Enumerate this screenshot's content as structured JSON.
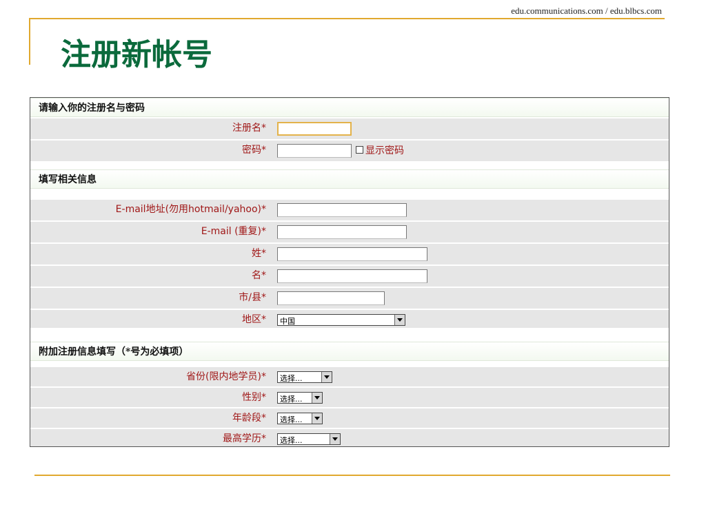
{
  "slide": {
    "source": "edu.communications.com / edu.blbcs.com",
    "title": "注册新帐号"
  },
  "form": {
    "sections": {
      "account": "请输入你的注册名与密码",
      "info": "填写相关信息",
      "extra": "附加注册信息填写（*号为必填项）"
    },
    "fields": {
      "username": {
        "label": "注册名*",
        "value": ""
      },
      "password": {
        "label": "密码*",
        "value": "",
        "show_password_label": "显示密码"
      },
      "email": {
        "label": "E-mail地址(勿用hotmail/yahoo)*",
        "value": ""
      },
      "email_confirm": {
        "label": "E-mail (重复)*",
        "value": ""
      },
      "last_name": {
        "label": "姓*",
        "value": ""
      },
      "first_name": {
        "label": "名*",
        "value": ""
      },
      "city": {
        "label": "市/县*",
        "value": ""
      },
      "region": {
        "label": "地区*",
        "selected": "中国"
      },
      "province": {
        "label": "省份(限内地学员)*",
        "selected": "选择..."
      },
      "gender": {
        "label": "性别*",
        "selected": "选择..."
      },
      "age_group": {
        "label": "年龄段*",
        "selected": "选择..."
      },
      "education": {
        "label": "最高学历*",
        "selected": "选择..."
      }
    }
  },
  "colors": {
    "title": "#0b6a3c",
    "accent_rule": "#e0a82e",
    "label": "#a01818",
    "row_bg": "#e6e6e6"
  }
}
